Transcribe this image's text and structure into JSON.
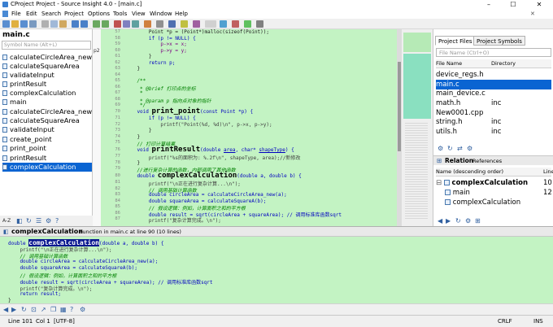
{
  "window": {
    "title": "CProject Project - Source Insight 4.0 - [main.c]",
    "minimize": "–",
    "maximize": "☐",
    "close": "✕"
  },
  "menu": [
    "File",
    "Edit",
    "Search",
    "Project",
    "Options",
    "Tools",
    "View",
    "Window",
    "Help"
  ],
  "symbol_panel": {
    "file": "main.c",
    "search_placeholder": "Symbol Name (Alt+L)",
    "items": [
      "calculateCircleArea_new",
      "calculateSquareArea",
      "validateInput",
      "printResult",
      "complexCalculation",
      "main",
      "calculateCircleArea_new",
      "calculateSquareArea",
      "validateInput",
      "create_point",
      "print_point",
      "printResult",
      "complexCalculation"
    ],
    "selected_index": 12,
    "footer": "A-Z"
  },
  "editor": {
    "p2_marker": "p2",
    "lines": [
      {
        "n": "57",
        "t": "        Point *p = (Point*)malloc(sizeof(Point));"
      },
      {
        "n": "58",
        "t": "        if (p != NULL) {"
      },
      {
        "n": "59",
        "t": "            p->x = x;"
      },
      {
        "n": "60",
        "t": "            p->y = y;"
      },
      {
        "n": "61",
        "t": "        }"
      },
      {
        "n": "62",
        "t": "        return p;"
      },
      {
        "n": "63",
        "t": "    }"
      },
      {
        "n": "64",
        "t": ""
      },
      {
        "n": "65",
        "t": "    /**"
      },
      {
        "n": "66",
        "t": "     * @brief 打印点的坐标"
      },
      {
        "n": "67",
        "t": "     *"
      },
      {
        "n": "68",
        "t": "     * @param p 指向点对象的指针"
      },
      {
        "n": "69",
        "t": "     */"
      },
      {
        "n": "70",
        "t": "    void print_point(const Point *p) {"
      },
      {
        "n": "71",
        "t": "        if (p != NULL) {"
      },
      {
        "n": "72",
        "t": "            printf(\"Point(%d, %d)\\n\", p->x, p->y);"
      },
      {
        "n": "73",
        "t": "        }"
      },
      {
        "n": "74",
        "t": "    }"
      },
      {
        "n": "75",
        "t": "    // 打印计算结果"
      },
      {
        "n": "76",
        "t": "    void printResult(double area, char* shapeType) {"
      },
      {
        "n": "77",
        "t": "        printf(\"%s的面积为: %.2f\\n\", shapeType, area);//新修改"
      },
      {
        "n": "78",
        "t": "    }"
      },
      {
        "n": "79",
        "t": "    //进行复杂计算的函数，内部调用了其他函数"
      },
      {
        "n": "80",
        "t": "    double complexCalculation(double a, double b) {"
      },
      {
        "n": "81",
        "t": "        printf(\"\\n正在进行复杂计算...\\n\");"
      },
      {
        "n": "82",
        "t": "        // 调用基础计算函数"
      },
      {
        "n": "83",
        "t": "        double circleArea = calculateCircleArea_new(a);"
      },
      {
        "n": "84",
        "t": "        double squareArea = calculateSquareA(b);"
      },
      {
        "n": "85",
        "t": "        // 假设逻辑：例如，计算面积之和的平方根"
      },
      {
        "n": "86",
        "t": "        double result = sqrt(circleArea + squareArea); // 调用标准库函数sqrt"
      },
      {
        "n": "87",
        "t": "        printf(\"复杂计算完成。\\n\");"
      }
    ]
  },
  "right_panel": {
    "tabs": [
      "Project Files",
      "Project Symbols"
    ],
    "file_search_placeholder": "File Name (Ctrl+O)",
    "columns": [
      "File Name",
      "Directory"
    ],
    "files": [
      {
        "name": "device_regs.h",
        "dir": ""
      },
      {
        "name": "main.c",
        "dir": ""
      },
      {
        "name": "main_device.c",
        "dir": ""
      },
      {
        "name": "math.h",
        "dir": "inc"
      },
      {
        "name": "New0001.cpp",
        "dir": ""
      },
      {
        "name": "string.h",
        "dir": "inc"
      },
      {
        "name": "utils.h",
        "dir": "inc"
      }
    ],
    "selected_file": 1,
    "relation_title": "Relation",
    "relation_subtitle": "References",
    "relation_columns": [
      "Name (descending order)",
      "Line"
    ],
    "relation_rows": [
      {
        "name": "complexCalculation",
        "line": "10"
      },
      {
        "name": "main",
        "line": "12"
      },
      {
        "name": "complexCalculation",
        "line": ""
      }
    ]
  },
  "context": {
    "symbol": "complexCalculation",
    "info": "Function in main.c at line 90 (10 lines)",
    "lines": [
      "double complexCalculation(double a, double b) {",
      "    printf(\"\\n正在进行复杂计算...\\n\");",
      "    // 调用基础计算函数",
      "    double circleArea = calculateCircleArea_new(a);",
      "    double squareArea = calculateSquareA(b);",
      "    // 假设逻辑：例如，计算面积之和的平方根",
      "    double result = sqrt(circleArea + squareArea); // 调用标准库函数sqrt",
      "    printf(\"复杂计算完成。\\n\");",
      "    return result;",
      "}"
    ]
  },
  "status": {
    "line": "Line 101",
    "col": "Col 1",
    "encoding": "[UTF-8]",
    "eol": "CRLF",
    "mode": "INS"
  },
  "colors": {
    "editor_bg": "#c3f3c3",
    "selection": "#0a64d2",
    "keyword": "#0000c0",
    "comment": "#008000"
  }
}
